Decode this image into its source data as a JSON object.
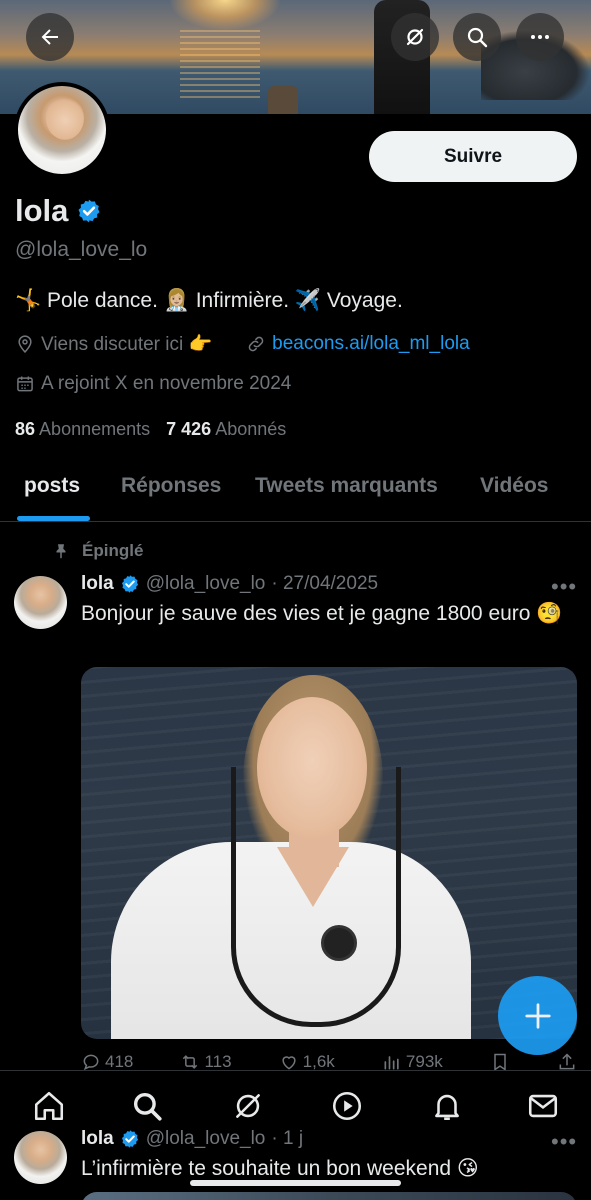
{
  "profile": {
    "follow_label": "Suivre",
    "name": "lola",
    "handle": "@lola_love_lo",
    "bio": "🤸 Pole dance. 👩🏼‍⚕️ Infirmière. ✈️ Voyage.",
    "location": "Viens discuter ici 👉",
    "website": "beacons.ai/lola_ml_lola",
    "joined": "A rejoint X en novembre 2024",
    "following_count": "86",
    "following_label": "Abonnements",
    "followers_count": "7 426",
    "followers_label": "Abonnés",
    "verified_color": "#1d9bf0"
  },
  "header_icons": [
    "back-arrow-icon",
    "grok-icon",
    "search-icon",
    "more-icon"
  ],
  "tabs": [
    {
      "label": "posts",
      "active": true
    },
    {
      "label": "Réponses",
      "active": false
    },
    {
      "label": "Tweets marquants",
      "active": false
    },
    {
      "label": "Vidéos",
      "active": false
    }
  ],
  "pinned_label": "Épinglé",
  "tweets": [
    {
      "name": "lola",
      "handle": "@lola_love_lo",
      "time": "· 27/04/2025",
      "text": "Bonjour je sauve des vies et je gagne 1800 euro 🧐",
      "replies": "418",
      "retweets": "113",
      "likes": "1,6k",
      "views": "793k"
    },
    {
      "name": "lola",
      "handle": "@lola_love_lo",
      "time": "· 1 j",
      "text": "L’infirmière te souhaite un bon weekend 😘"
    }
  ],
  "more_glyph": "•••",
  "bottom_nav": [
    "home-icon",
    "search-icon",
    "grok-icon",
    "video-icon",
    "notifications-icon",
    "messages-icon"
  ],
  "accent": "#1d9bf0"
}
